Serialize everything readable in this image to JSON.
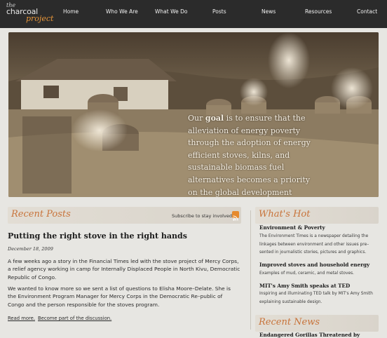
{
  "logo": {
    "the": "the",
    "charcoal": "charcoal",
    "project": "project"
  },
  "nav": [
    "Home",
    "Who We Are",
    "What We Do",
    "Posts",
    "News",
    "Resources",
    "Contact"
  ],
  "hero": {
    "pre": "Our",
    "goal_word": "goal",
    "post": "is to ensure that the alleviation of energy poverty through the adoption of energy efficient stoves, kilns, and sustainable biomass fuel alternatives becomes a priority on the global development agenda."
  },
  "recent_posts": {
    "heading": "Recent Posts",
    "subscribe_label": "Subscribe to stay involved.",
    "post": {
      "title": "Putting the right stove in the right hands",
      "date": "December 18, 2009",
      "para1": "A few weeks ago a story in the Financial Times led with the stove project of Mercy Corps, a relief agency working in camp for Internally Displaced People in North Kivu, Democratic Republic of Congo.",
      "para2": "We wanted to know more so we sent a list of questions to Elisha Moore–Delate. She is the Environment Program Manager for Mercy Corps in the Democratic Re–public of Congo and the person responsible for the stoves program.",
      "read_more": "Read more.",
      "discuss": "Become part of the discussion."
    }
  },
  "whats_hot": {
    "heading": "What's Hot",
    "items": [
      {
        "title": "Environment & Poverty",
        "desc": "The Environment Times is a newspaper detailing the linkages between environment and other issues pre–sented in journalistic stories, pictures and graphics."
      },
      {
        "title": "Improved stoves and household energy",
        "desc": "Examples of mud, ceramic, and metal stoves."
      },
      {
        "title": "MIT's Amy Smith speaks at TED",
        "desc": "Inspiring and illuminating TED talk by MIT's Amy Smith explaining sustainable design."
      }
    ]
  },
  "recent_news": {
    "heading": "Recent News",
    "items": [
      {
        "title": "Endangered Gorillas Threatened by"
      }
    ]
  },
  "colors": {
    "header_bg": "#2b2b2b",
    "accent": "#c8733a",
    "rss": "#e68a2e"
  }
}
